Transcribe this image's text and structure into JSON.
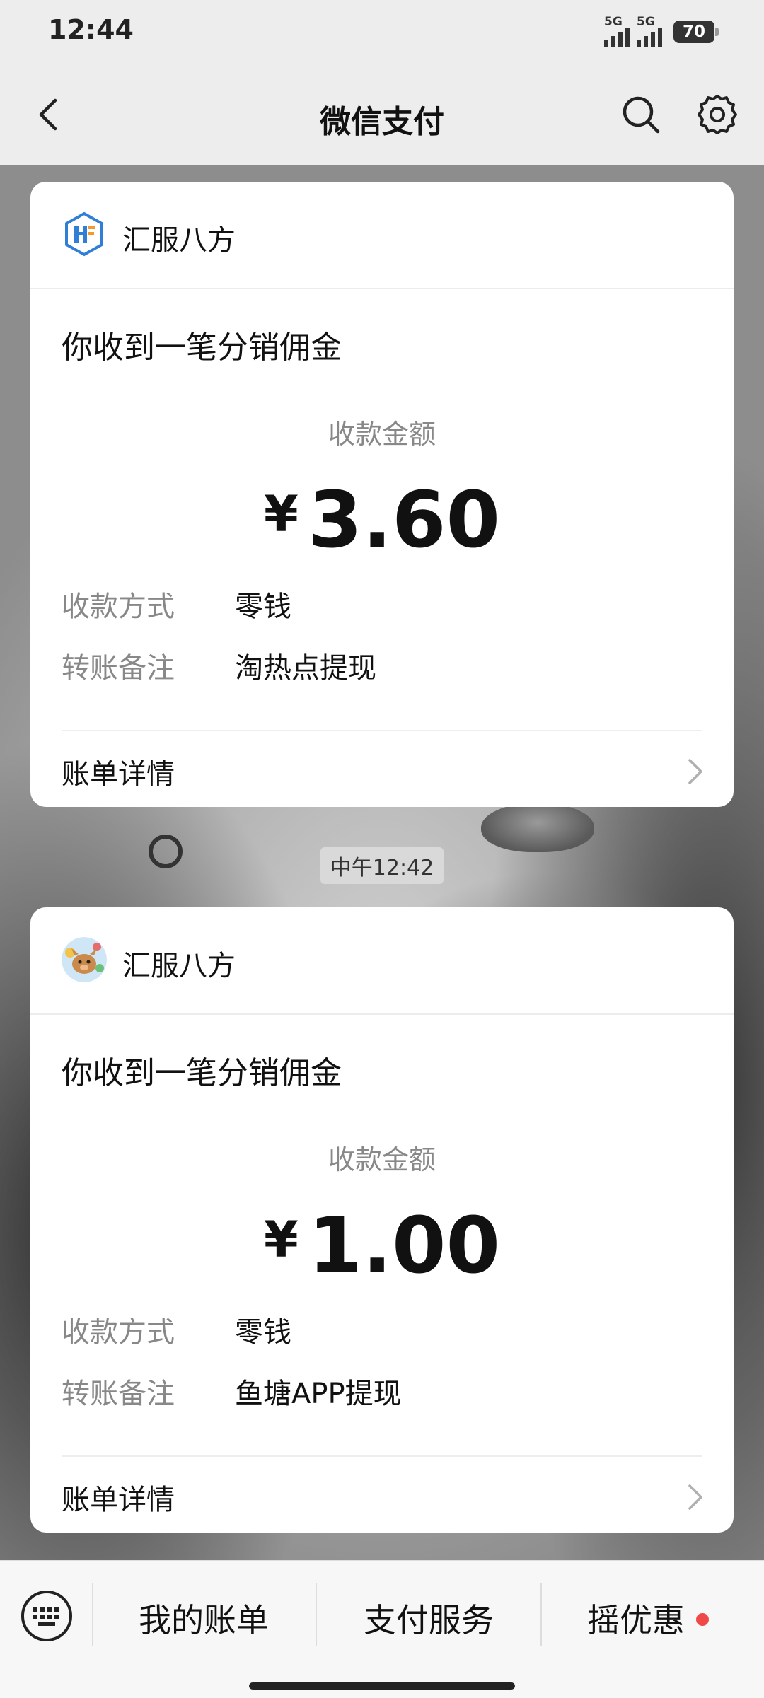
{
  "status_bar": {
    "time": "12:44",
    "battery": "70",
    "network": "5G"
  },
  "nav": {
    "title": "微信支付"
  },
  "messages": [
    {
      "merchant": "汇服八方",
      "title": "你收到一笔分销佣金",
      "amount_label": "收款金额",
      "currency": "¥",
      "amount": "3.60",
      "row1_label": "收款方式",
      "row1_value": "零钱",
      "row2_label": "转账备注",
      "row2_value": "淘热点提现",
      "detail_label": "账单详情"
    },
    {
      "merchant": "汇服八方",
      "title": "你收到一笔分销佣金",
      "amount_label": "收款金额",
      "currency": "¥",
      "amount": "1.00",
      "row1_label": "收款方式",
      "row1_value": "零钱",
      "row2_label": "转账备注",
      "row2_value": "鱼塘APP提现",
      "detail_label": "账单详情"
    }
  ],
  "timestamp": "中午12:42",
  "bottom_menu": {
    "item1": "我的账单",
    "item2": "支付服务",
    "item3": "摇优惠"
  },
  "colors": {
    "badge_red": "#f04848",
    "logo_blue": "#2f7fd6",
    "logo_orange": "#f39a2b"
  }
}
